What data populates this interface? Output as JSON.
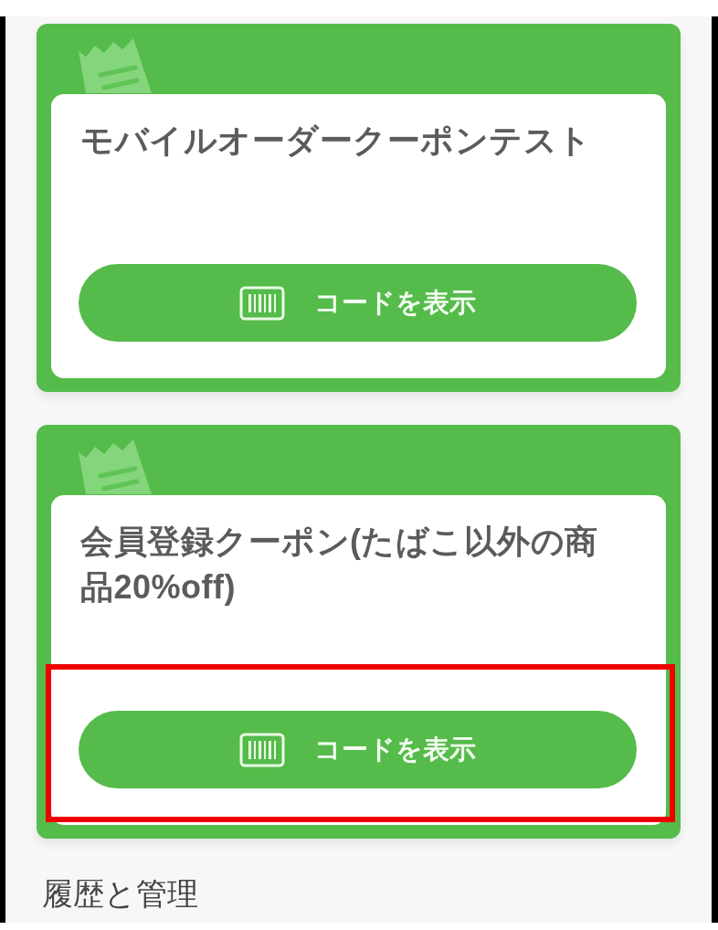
{
  "coupons": [
    {
      "title": "モバイルオーダークーポンテスト",
      "button": "コードを表示",
      "highlighted": false
    },
    {
      "title": "会員登録クーポン(たばこ以外の商品20%off)",
      "button": "コードを表示",
      "highlighted": true
    }
  ],
  "section_heading": "履歴と管理"
}
